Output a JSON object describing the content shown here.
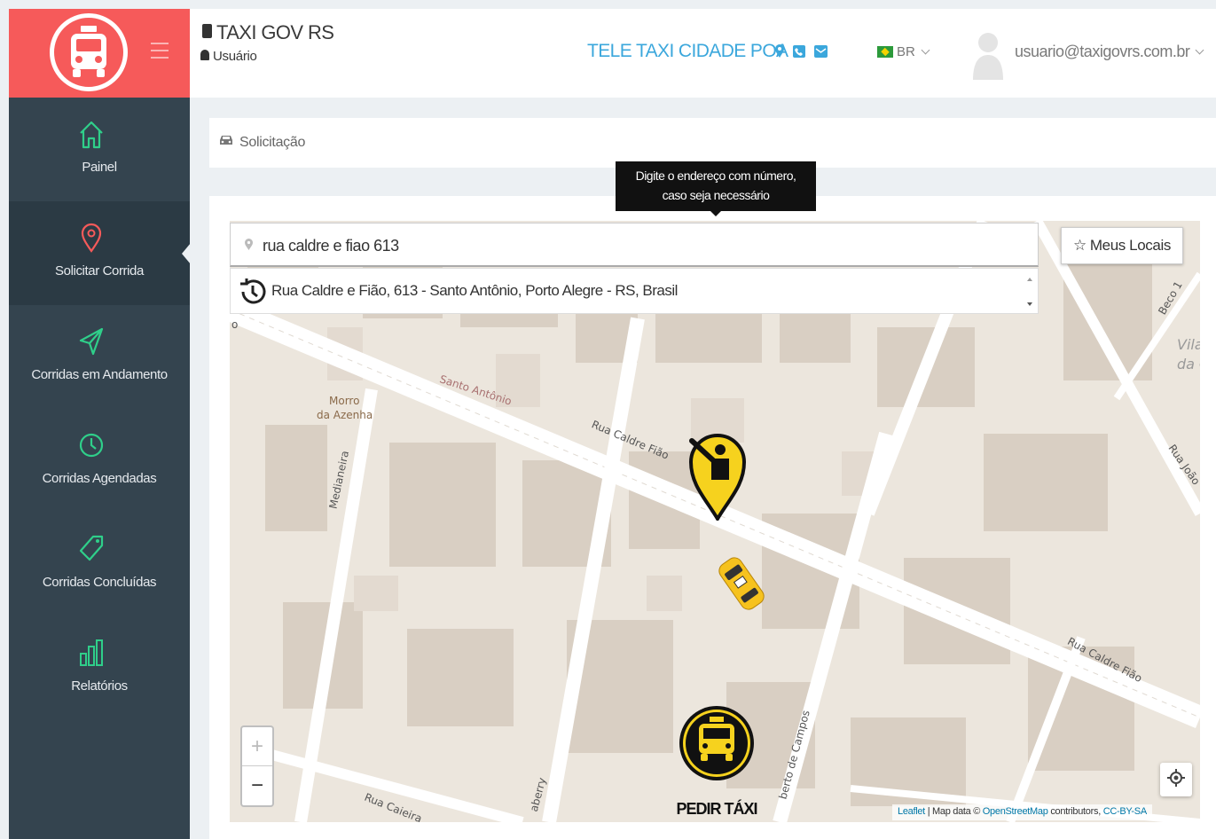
{
  "header": {
    "app_title": "TAXI GOV RS",
    "user_role": "Usuário",
    "company": "TELE TAXI CIDADE POA",
    "company_icons": [
      "map-marker-icon",
      "phone-icon",
      "envelope-icon"
    ],
    "language": "BR",
    "user_email": "usuario@taxigovrs.com.br"
  },
  "sidebar": {
    "items": [
      {
        "label": "Painel",
        "icon": "home-icon",
        "active": false
      },
      {
        "label": "Solicitar Corrida",
        "icon": "map-pin-icon",
        "active": true
      },
      {
        "label": "Corridas em Andamento",
        "icon": "paper-plane-icon",
        "active": false
      },
      {
        "label": "Corridas Agendadas",
        "icon": "clock-icon",
        "active": false
      },
      {
        "label": "Corridas Concluídas",
        "icon": "tag-icon",
        "active": false
      },
      {
        "label": "Relatórios",
        "icon": "bar-chart-icon",
        "active": false
      }
    ]
  },
  "breadcrumb": {
    "label": "Solicitação"
  },
  "tooltip": {
    "line1": "Digite o endereço com número,",
    "line2": "caso seja necessário"
  },
  "search": {
    "value": "rua caldre e fiao 613"
  },
  "suggestion": {
    "text": "Rua Caldre e Fião, 613 - Santo Antônio, Porto Alegre - RS, Brasil"
  },
  "meus_locais": {
    "label": "Meus Locais"
  },
  "map": {
    "street_labels": {
      "caldre_fiao_1": "Rua Caldre Fião",
      "caldre_fiao_2": "Rua Caldre Fião",
      "santo_antonio": "Santo Antônio",
      "morro_1": "Morro",
      "morro_2": "da Azenha",
      "medianeira": "Medianeira",
      "caieira": "Rua Caieira",
      "aberry": "aberry",
      "roberto": "berto de Campos",
      "beco": "Beco 1",
      "joao": "Rua João",
      "vila_1": "Vila",
      "vila_2": "da C",
      "edge_o": "o"
    },
    "zoom_in": "+",
    "zoom_out": "−",
    "attribution": {
      "leaflet": "Leaflet",
      "sep": " | Map data © ",
      "osm": "OpenStreetMap",
      "contrib": " contributors, ",
      "license": "CC-BY-SA"
    }
  },
  "pedir_taxi": {
    "label": "PEDIR TÁXI"
  },
  "colors": {
    "brand": "#f65a5a",
    "sidebar": "#34444f",
    "accent_icons": "#2fcf8a",
    "company": "#3ba7dc",
    "taxi_yellow": "#f6d21e"
  }
}
